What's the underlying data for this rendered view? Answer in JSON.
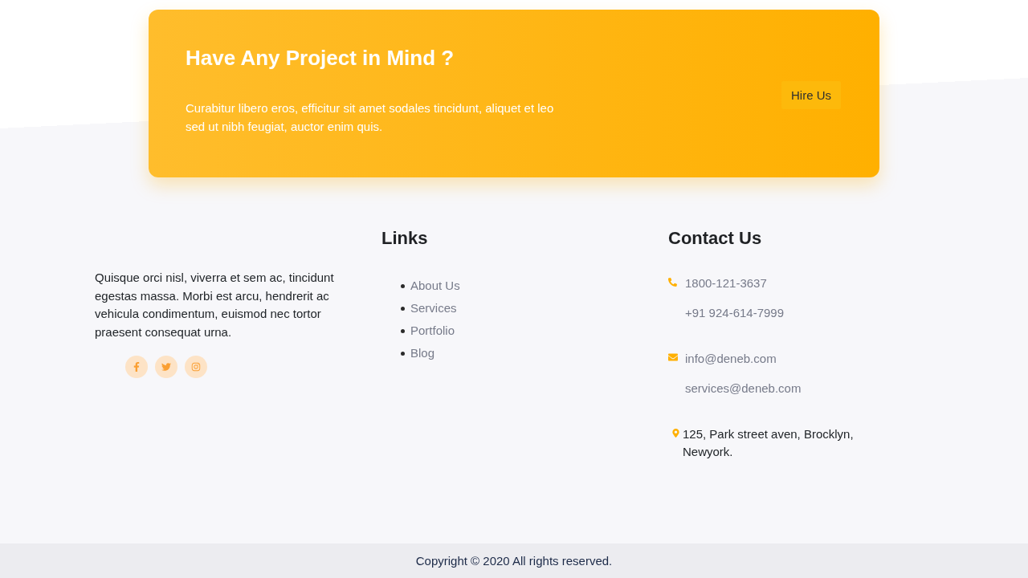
{
  "cta": {
    "title": "Have Any Project in Mind ?",
    "text": "Curabitur libero eros, efficitur sit amet sodales tincidunt, aliquet et leo sed ut nibh feugiat, auctor enim quis.",
    "button": "Hire Us"
  },
  "about": {
    "text": "Quisque orci nisl, viverra et sem ac, tincidunt egestas massa. Morbi est arcu, hendrerit ac vehicula condimentum, euismod nec tortor praesent consequat urna.",
    "social_links": [
      {
        "kind": "facebook"
      },
      {
        "kind": "twitter"
      },
      {
        "kind": "instagram"
      }
    ]
  },
  "links": {
    "title": "Links",
    "items": [
      "About Us",
      "Services",
      "Portfolio",
      "Blog"
    ]
  },
  "contact": {
    "title": "Contact Us",
    "groups": [
      {
        "kind": "phone",
        "lines": [
          "1800-121-3637",
          "+91 924-614-7999"
        ]
      },
      {
        "kind": "email",
        "lines": [
          "info@deneb.com",
          "services@deneb.com"
        ]
      },
      {
        "kind": "address",
        "lines": [
          "125, Park street aven, Brocklyn, Newyork."
        ]
      }
    ]
  },
  "copyright": "Copyright © 2020 All rights reserved."
}
